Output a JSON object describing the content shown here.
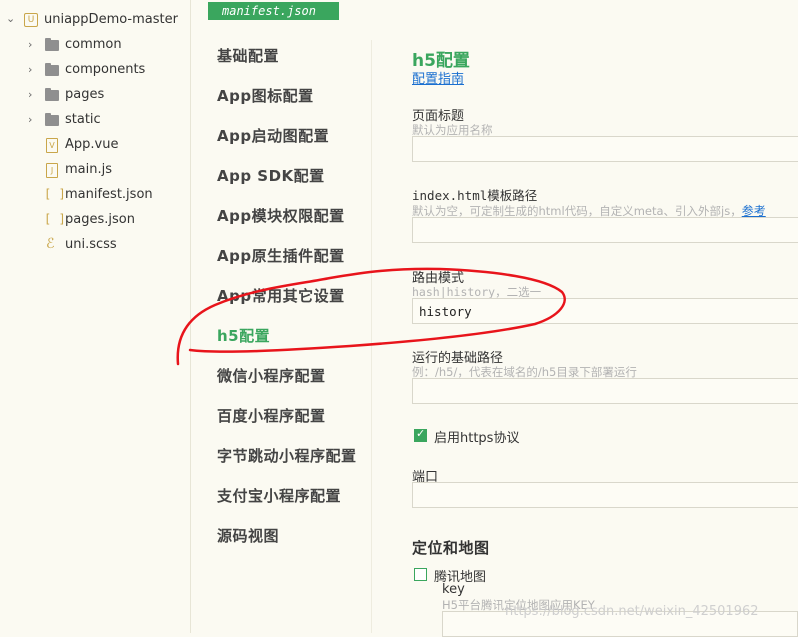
{
  "project_tree": {
    "root": "uniappDemo-master",
    "items": [
      {
        "label": "common",
        "icon": "folder-icon"
      },
      {
        "label": "components",
        "icon": "folder-icon"
      },
      {
        "label": "pages",
        "icon": "folder-icon"
      },
      {
        "label": "static",
        "icon": "folder-icon"
      },
      {
        "label": "App.vue",
        "icon": "vue-file-icon",
        "glyph": "V"
      },
      {
        "label": "main.js",
        "icon": "js-file-icon",
        "glyph": "J"
      },
      {
        "label": "manifest.json",
        "icon": "json-file-icon",
        "glyph": "[ ]"
      },
      {
        "label": "pages.json",
        "icon": "json-file-icon",
        "glyph": "[ ]"
      },
      {
        "label": "uni.scss",
        "icon": "scss-file-icon",
        "glyph": "ℰ"
      }
    ]
  },
  "editor_tab": "manifest.json",
  "nav": {
    "items": [
      "基础配置",
      "App图标配置",
      "App启动图配置",
      "App SDK配置",
      "App模块权限配置",
      "App原生插件配置",
      "App常用其它设置",
      "h5配置",
      "微信小程序配置",
      "百度小程序配置",
      "字节跳动小程序配置",
      "支付宝小程序配置",
      "源码视图"
    ],
    "active": "h5配置"
  },
  "panel": {
    "title": "h5配置",
    "guide_link": "配置指南",
    "page_title": {
      "label": "页面标题",
      "hint": "默认为应用名称",
      "value": ""
    },
    "template_path": {
      "label": "index.html模板路径",
      "hint": "默认为空，可定制生成的html代码，自定义meta、引入外部js，",
      "hint_link": "参考",
      "value": ""
    },
    "router_mode": {
      "label": "路由模式",
      "hint": "hash|history，二选一",
      "value": "history"
    },
    "base_path": {
      "label": "运行的基础路径",
      "hint": "例：/h5/，代表在域名的/h5目录下部署运行",
      "value": ""
    },
    "https": {
      "label": "启用https协议",
      "checked": true
    },
    "port": {
      "label": "端口",
      "value": ""
    },
    "location_title": "定位和地图",
    "tencent_map": {
      "label": "腾讯地图",
      "checked": false
    },
    "key": {
      "label": "key",
      "hint": "H5平台腾讯定位地图应用KEY",
      "value": ""
    }
  },
  "watermark": "https://blog.csdn.net/weixin_42501962",
  "colors": {
    "accent": "#3aa65e",
    "link": "#1a6fd0",
    "annotation": "#e8141b"
  }
}
